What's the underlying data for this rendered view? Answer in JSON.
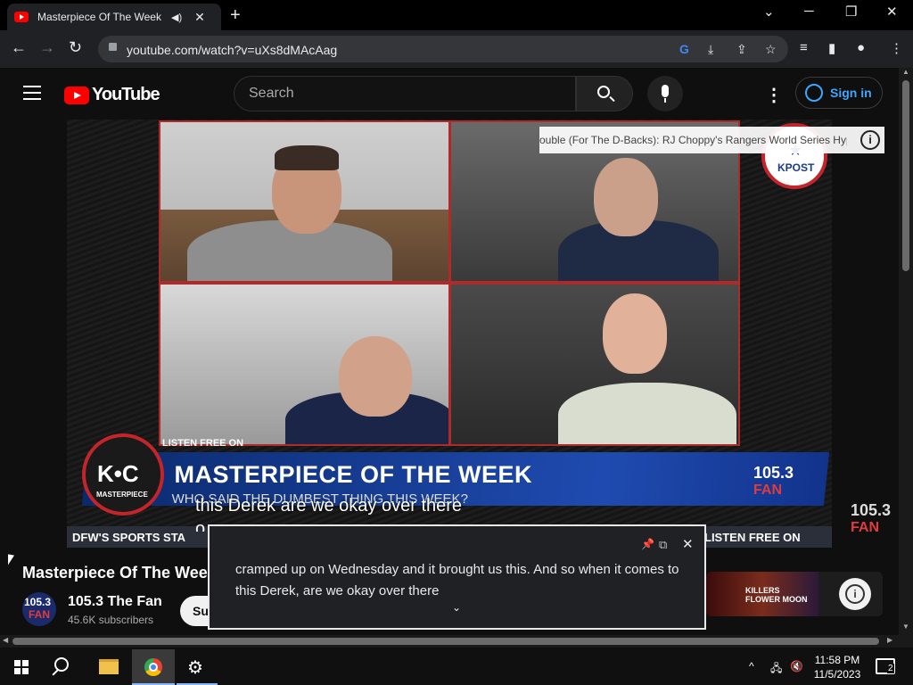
{
  "browser": {
    "tab_title": "Masterpiece Of The Week: K",
    "new_tab": "+",
    "url": "youtube.com/watch?v=uXs8dMAcAag",
    "min": "─",
    "restore": "❐",
    "close": "✕",
    "chevron": "⌄"
  },
  "youtube": {
    "logo_text": "YouTube",
    "search_placeholder": "Search",
    "sign_in": "Sign in",
    "more_menu": "⋮"
  },
  "video": {
    "endscreen_title": "ouble (For The D-Backs): RJ Choppy's Rangers World Series Hyp...",
    "endscreen_info": "i",
    "banner_title": "MASTERPIECE OF THE WEEK",
    "banner_sub": "WHO SAID THE DUMBEST THING THIS WEEK?",
    "listen_free_top": "LISTEN FREE ON",
    "badge_kc": "K•C",
    "badge_masterpiece": "MASTERPIECE",
    "station_num": "105.3",
    "station_fan": "FAN",
    "ticker_left": "DFW'S SPORTS STA",
    "ticker_right": "LISTEN FREE ON",
    "kpost": "KPOST",
    "caption_line1": "this Derek are we okay over there",
    "caption_line2": "o"
  },
  "below": {
    "title": "Masterpiece Of The Week: K",
    "channel_name": "105.3 The Fan",
    "channel_subs": "45.6K subscribers",
    "avatar_top": "105.3",
    "avatar_fan": "FAN",
    "subscribe_partial": "Su",
    "ad_line1": "KILLERS",
    "ad_line2": "FLOWER MOON",
    "ad_info": "i",
    "side_num": "105.3",
    "side_fan": "FAN"
  },
  "live_caption": {
    "text": "cramped up on Wednesday and it brought us this. And so when it comes to this Derek, are we okay over there",
    "expand": "⌄",
    "close": "✕"
  },
  "taskbar": {
    "time": "11:58 PM",
    "date": "11/5/2023",
    "notifications": "2",
    "settings_glyph": "⚙",
    "tray_up": "^"
  }
}
